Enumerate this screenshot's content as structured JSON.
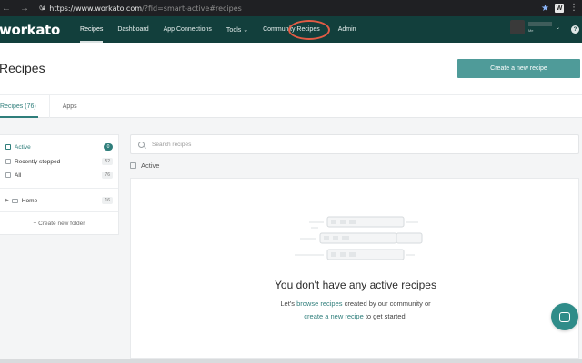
{
  "browser": {
    "url_main": "https://www.workato.com",
    "url_rest": "/?fid=smart-active#recipes",
    "extension_label": "W"
  },
  "nav": {
    "brand": "workato",
    "items": [
      {
        "label": "Recipes"
      },
      {
        "label": "Dashboard"
      },
      {
        "label": "App Connections"
      },
      {
        "label": "Tools ⌄"
      },
      {
        "label": "Community Recipes"
      },
      {
        "label": "Admin"
      }
    ],
    "user_sub": "Me",
    "help_glyph": "?"
  },
  "header": {
    "title": "Recipes",
    "create_label": "Create a new recipe",
    "tabs": [
      {
        "label": "Recipes (76)"
      },
      {
        "label": "Apps"
      }
    ]
  },
  "sidebar": {
    "items": [
      {
        "label": "Active",
        "count": "0"
      },
      {
        "label": "Recently stopped",
        "count": "52"
      },
      {
        "label": "All",
        "count": "76"
      }
    ],
    "folder": {
      "label": "Home",
      "count": "16"
    },
    "new_folder": "+ Create new folder"
  },
  "main": {
    "search_placeholder": "Search recipes",
    "section_label": "Active",
    "empty_title": "You don't have any active recipes",
    "line1_prefix": "Let's ",
    "line1_link": "browse recipes",
    "line1_suffix": " created by our community or",
    "line2_link": "create a new recipe",
    "line2_suffix": " to get started."
  },
  "colors": {
    "nav_bg": "#123f3c",
    "accent": "#2f7e7b",
    "button": "#4f9b99",
    "highlight_ring": "#e25b45"
  }
}
